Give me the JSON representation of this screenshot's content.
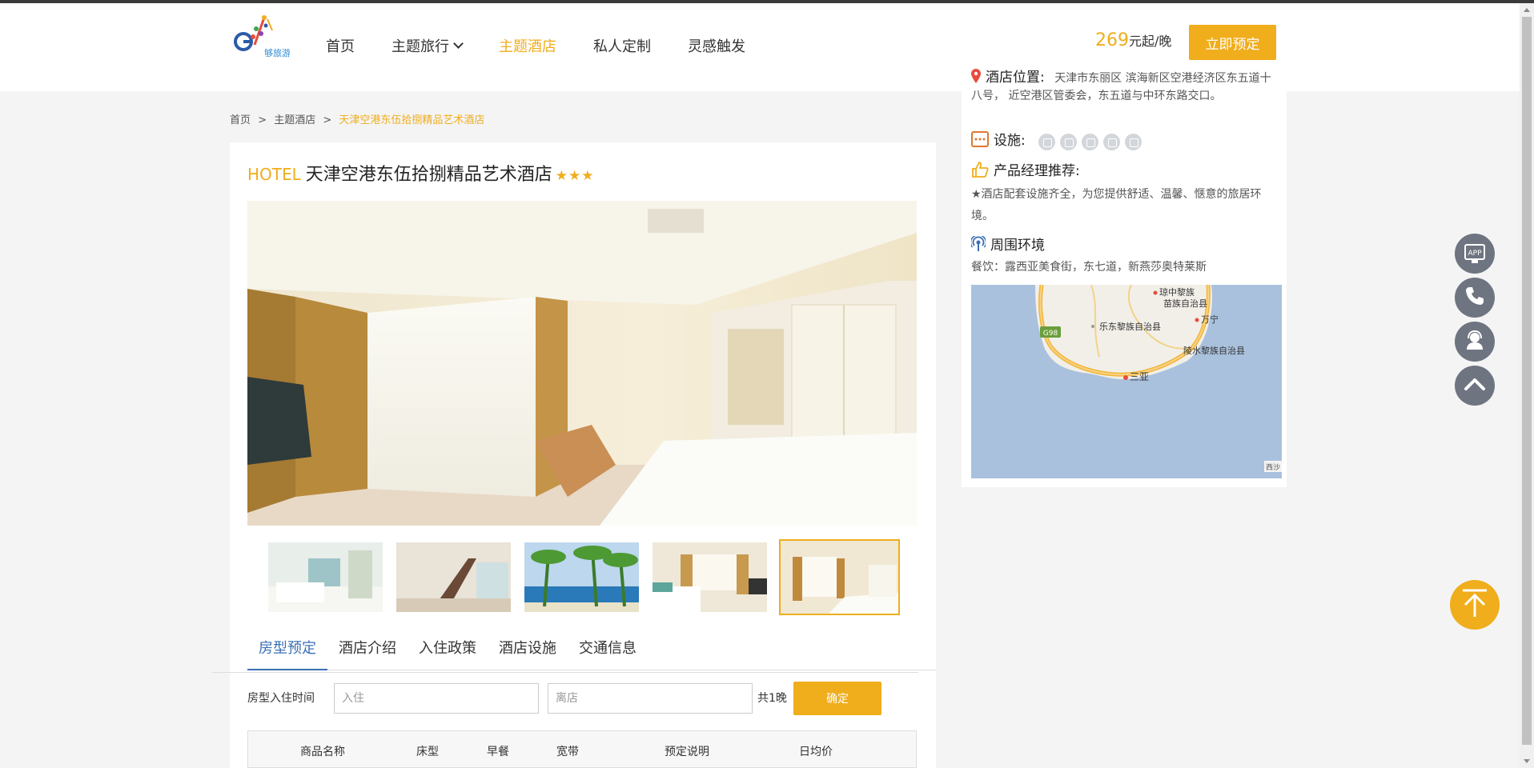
{
  "header": {
    "logo_text": "够旅游",
    "nav": [
      {
        "label": "首页"
      },
      {
        "label": "主题旅行"
      },
      {
        "label": "主题酒店"
      },
      {
        "label": "私人定制"
      },
      {
        "label": "灵感触发"
      }
    ],
    "active_nav": "主题酒店",
    "price_value": "269",
    "price_unit": "元起/晚",
    "book_button": "立即预定"
  },
  "breadcrumb": {
    "items": [
      "首页",
      "主题酒店"
    ],
    "separator": ">",
    "current": "天津空港东伍拾捌精品艺术酒店"
  },
  "hotel": {
    "prefix": "HOTEL",
    "name": "天津空港东伍拾捌精品艺术酒店",
    "stars": "★★★",
    "star_count": 3,
    "thumbnails": 5,
    "active_thumbnail": 5
  },
  "tabs": [
    "房型预定",
    "酒店介绍",
    "入住政策",
    "酒店设施",
    "交通信息"
  ],
  "booking": {
    "label": "房型入住时间",
    "checkin_placeholder": "入住",
    "checkout_placeholder": "离店",
    "nights": "共1晚",
    "confirm": "确定"
  },
  "table": {
    "headers": [
      "商品名称",
      "床型",
      "早餐",
      "宽带",
      "预定说明",
      "日均价"
    ]
  },
  "side": {
    "location_label": "酒店位置:",
    "location_text": "天津市东丽区 滨海新区空港经济区东五道十八号， 近空港区管委会，东五道与中环东路交口。",
    "facilities_label": "设施:",
    "facility_icons": [
      "wifi-icon",
      "tv-icon",
      "phone-icon",
      "breakfast-icon",
      "parking-icon"
    ],
    "manager_label": "产品经理推荐:",
    "manager_text": "★酒店配套设施齐全，为您提供舒适、温馨、惬意的旅居环境。",
    "env_label": "周围环境",
    "env_text": "餐饮：露西亚美食街，东七道，新燕莎奥特莱斯",
    "map_labels": [
      "琼中黎族",
      "苗族自治县",
      "万宁",
      "乐东黎族自治县",
      "陵水黎族自治县",
      "三亚",
      "G98",
      "西沙"
    ]
  },
  "float_buttons": [
    "APP",
    "phone-icon",
    "service-icon",
    "up-icon"
  ],
  "colors": {
    "accent": "#f0ad1c",
    "tab_active": "#3b6fb4",
    "float": "#6e7480"
  }
}
